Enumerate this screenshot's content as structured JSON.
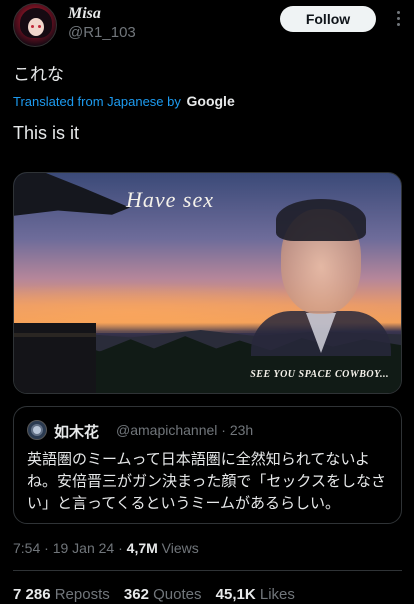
{
  "author": {
    "name": "Misa",
    "handle": "@R1_103",
    "avatar_icon": "avatar-image"
  },
  "header": {
    "follow_label": "Follow",
    "more_icon": "more-options-icon"
  },
  "post": {
    "original_text": "これな",
    "translated_label": "Translated from Japanese by",
    "translator": "Google",
    "translated_text": "This is it"
  },
  "media": {
    "overlay_text": "Have sex",
    "caption_text": "SEE YOU SPACE COWBOY..."
  },
  "quote": {
    "name": "如木花",
    "handle": "@amapichannel",
    "time": "23h",
    "body": "英語圏のミームって日本語圏に全然知られてないよね。安倍晋三がガン決まった顔で「セックスをしなさい」と言ってくるというミームがあるらしい。"
  },
  "meta": {
    "time": "7:54",
    "date": "19 Jan 24",
    "views_count": "4,7M",
    "views_label": "Views"
  },
  "stats": {
    "reposts_count": "7 286",
    "reposts_label": "Reposts",
    "quotes_count": "362",
    "quotes_label": "Quotes",
    "likes_count": "45,1K",
    "likes_label": "Likes"
  },
  "colors": {
    "background": "#000000",
    "text": "#e7e9ea",
    "secondary": "#71767b",
    "link": "#1d9bf0",
    "border": "#2f3336"
  }
}
